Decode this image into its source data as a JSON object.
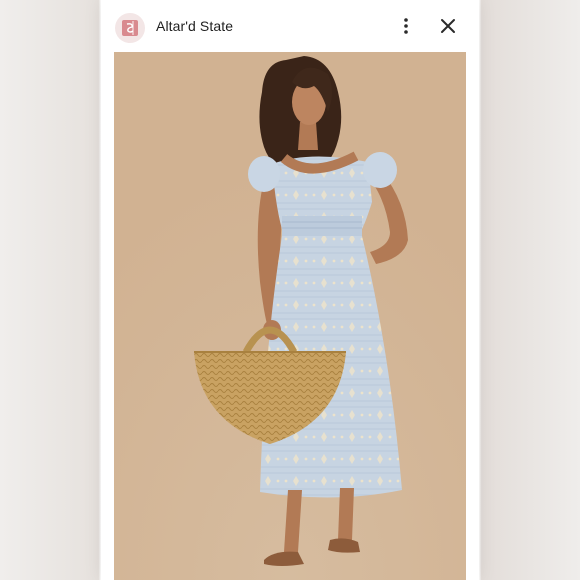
{
  "header": {
    "brand_name": "Altar'd State",
    "logo_icon": "altard-state-logo-icon",
    "more_icon": "more-vertical-icon",
    "close_icon": "close-icon"
  },
  "photo": {
    "subject": "product-photo",
    "colors": {
      "background": "#d5b898",
      "dress": "#c9d5e2",
      "embroidery": "#efe6cf",
      "bag": "#c9a262"
    }
  }
}
